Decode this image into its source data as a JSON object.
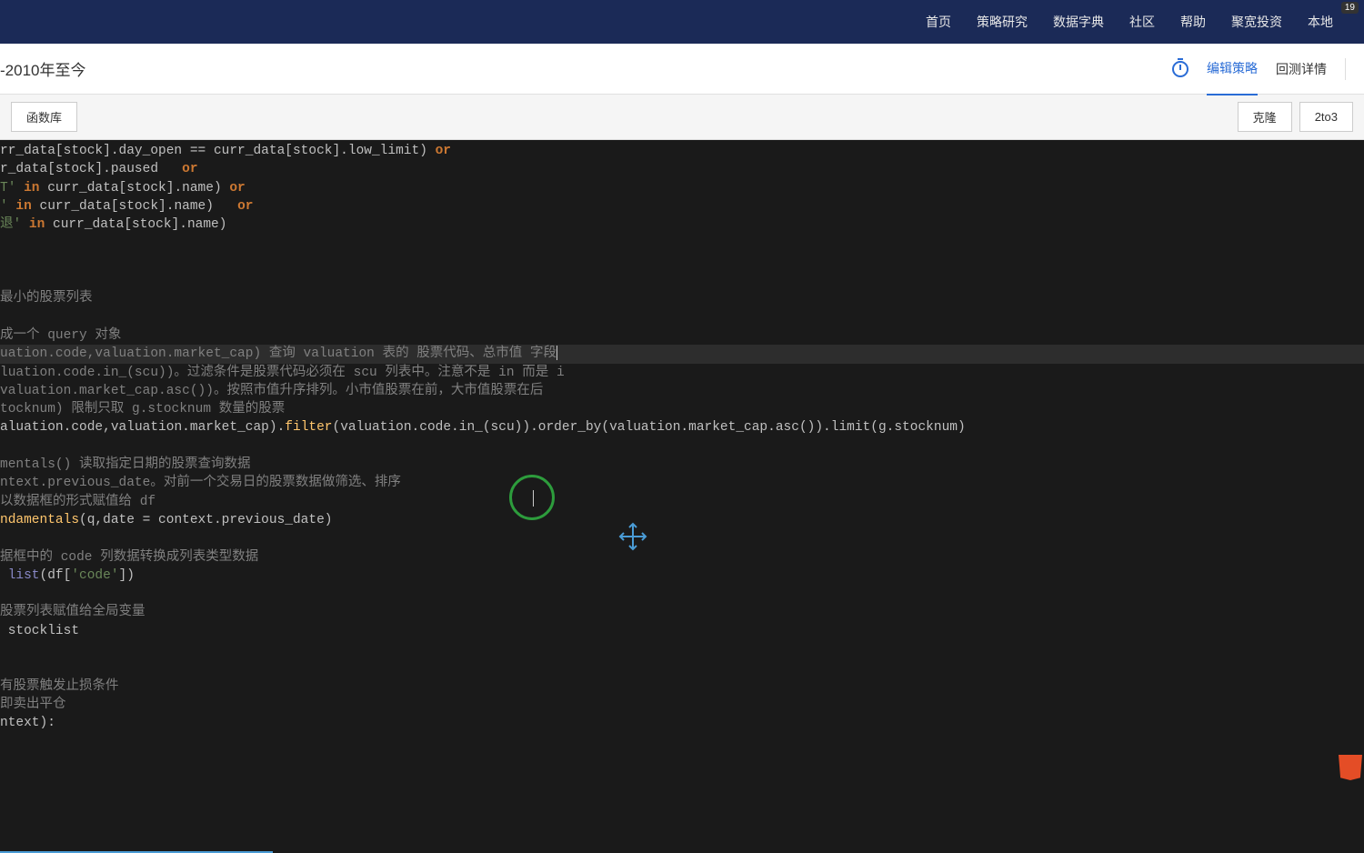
{
  "nav": {
    "items": [
      "首页",
      "策略研究",
      "数据字典",
      "社区",
      "帮助",
      "聚宽投资",
      "本地"
    ],
    "badge": "19"
  },
  "subheader": {
    "title": "-2010年至今",
    "tabs": {
      "edit": "编辑策略",
      "backtest": "回测详情"
    }
  },
  "toolbar": {
    "funclib": "函数库",
    "clone": "克隆",
    "to3": "2to3"
  },
  "code": {
    "l1a": "rr_data[stock].day_open ",
    "l1b": "==",
    "l1c": " curr_data[stock].low_limit) ",
    "l1d": "or",
    "l2a": "r_data[stock].paused   ",
    "l2b": "or",
    "l3a": "T'",
    "l3b": " in ",
    "l3c": "curr_data[stock].name) ",
    "l3d": "or",
    "l4a": "'",
    "l4b": " in ",
    "l4c": "curr_data[stock].name)   ",
    "l4d": "or",
    "l5a": "退'",
    "l5b": " in ",
    "l5c": "curr_data[stock].name)",
    "l6": "最小的股票列表",
    "l7": "成一个 query 对象",
    "l8": "uation.code,valuation.market_cap) 查询 valuation 表的 股票代码、总市值 字段",
    "l9": "luation.code.in_(scu))。过滤条件是股票代码必须在 scu 列表中。注意不是 in 而是 i",
    "l10": "valuation.market_cap.asc())。按照市值升序排列。小市值股票在前，大市值股票在后",
    "l11": "tocknum) 限制只取 g.stocknum 数量的股票",
    "l12_a": "aluation",
    "l12_b": ".code,",
    "l12_c": "valuation",
    "l12_d": ".market_cap).",
    "l12_e": "filter",
    "l12_f": "(",
    "l12_g": "valuation",
    "l12_h": ".code.in_(scu)).order_by(",
    "l12_i": "valuation",
    "l12_j": ".market_cap.asc()).limit(g.stocknum)",
    "l13": "mentals() 读取指定日期的股票查询数据",
    "l14": "ntext.previous_date。对前一个交易日的股票数据做筛选、排序",
    "l15": "以数据框的形式赋值给 df",
    "l16_a": "ndamentals",
    "l16_b": "(q,",
    "l16_c": "date",
    "l16_d": " = ",
    "l16_e": "context",
    "l16_f": ".previous_date)",
    "l17": "据框中的 code 列数据转换成列表类型数据",
    "l18_a": " list",
    "l18_b": "(df[",
    "l18_c": "'code'",
    "l18_d": "])",
    "l19": "股票列表赋值给全局变量",
    "l20": " stocklist",
    "l21": "有股票触发止损条件",
    "l22": "即卖出平仓",
    "l23_a": "ntext",
    "l23_b": "):"
  }
}
